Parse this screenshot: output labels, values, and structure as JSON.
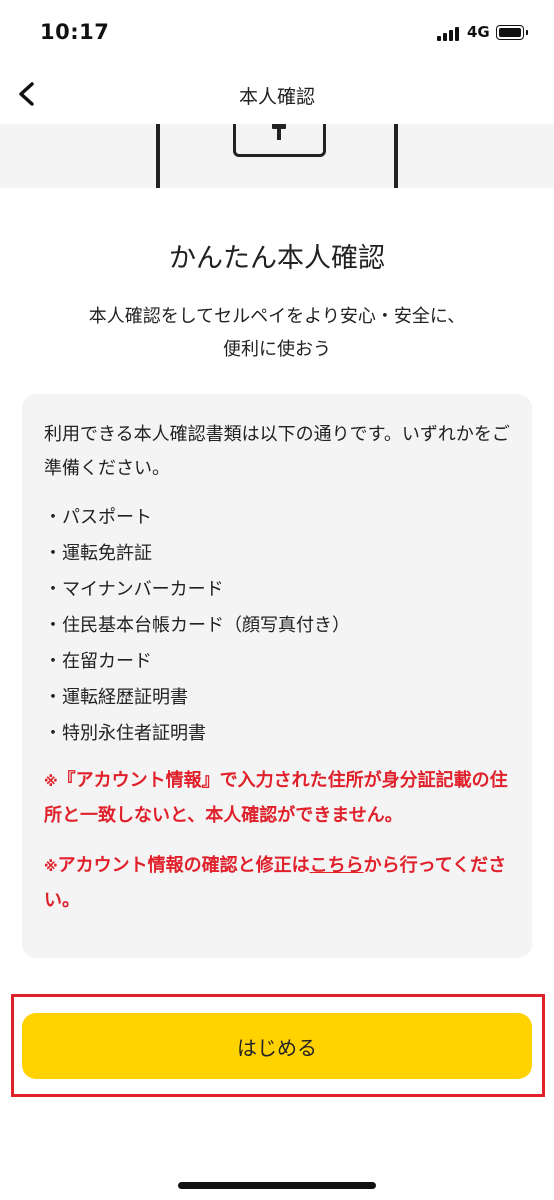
{
  "status_bar": {
    "time": "10:17",
    "network": "4G"
  },
  "nav": {
    "title": "本人確認",
    "back_icon": "chevron-left-icon"
  },
  "main": {
    "title": "かんたん本人確認",
    "subtitle_line1": "本人確認をしてセルペイをより安心・安全に、",
    "subtitle_line2": "便利に使おう"
  },
  "info": {
    "intro": "利用できる本人確認書類は以下の通りです。いずれかをご準備ください。",
    "documents": [
      "パスポート",
      "運転免許証",
      "マイナンバーカード",
      "住民基本台帳カード（顔写真付き）",
      "在留カード",
      "運転経歴証明書",
      "特別永住者証明書"
    ],
    "warning1_mark": "※",
    "warning1_text": "『アカウント情報』で入力された住所が身分証記載の住所と一致しないと、本人確認ができません。",
    "warning2_mark": "※",
    "warning2_prefix": "アカウント情報の確認と修正は",
    "warning2_link": "こちら",
    "warning2_suffix": "から行ってください。"
  },
  "cta": {
    "label": "はじめる",
    "color": "#ffd200"
  },
  "colors": {
    "warning": "#e0212b",
    "card_bg": "#f4f4f4",
    "highlight": "#e0212b"
  }
}
